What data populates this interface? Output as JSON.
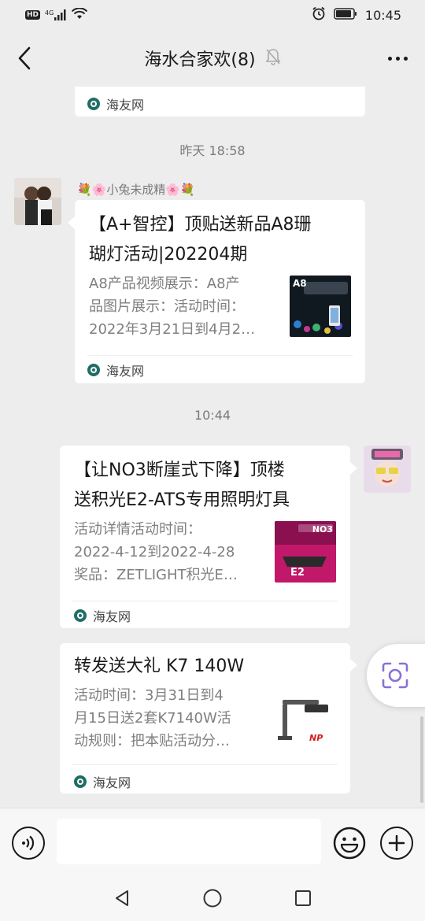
{
  "status_bar": {
    "hd": "HD",
    "network": "4G",
    "time": "10:45"
  },
  "header": {
    "title": "海水合家欢(8)",
    "mute_icon": "bell-off-icon",
    "more_icon": "more-dots-icon"
  },
  "messages": [
    {
      "source": "海友网"
    },
    {
      "timestamp": "昨天 18:58",
      "sender": "💐🌸小兔未成精🌸💐",
      "title_lines": [
        "【A+智控】顶贴送新品A8珊",
        "瑚灯活动|202204期"
      ],
      "desc_lines": [
        "A8产品视频展示：A8产",
        "品图片展示：活动时间：",
        "2022年3月21日到4月2…"
      ],
      "thumb_label": "A8",
      "source": "海友网"
    },
    {
      "timestamp": "10:44",
      "title_lines": [
        "【让NO3断崖式下降】顶楼",
        "送积光E2-ATS专用照明灯具"
      ],
      "desc_lines": [
        "活动详情活动时间：",
        "2022-4-12到2022-4-28",
        "奖品：ZETLIGHT积光E…"
      ],
      "thumb_label": "NO3",
      "thumb_label2": "E2",
      "source": "海友网"
    },
    {
      "title_lines": [
        "转发送大礼 K7 140W"
      ],
      "desc_lines": [
        "活动时间：3月31日到4",
        "月15日送2套K7140W活",
        "动规则：把本贴活动分…"
      ],
      "thumb_label": "NP",
      "source": "海友网"
    }
  ],
  "input": {
    "placeholder": "",
    "voice_icon": "voice-icon",
    "emoji_icon": "emoji-icon",
    "plus_icon": "plus-icon"
  },
  "colors": {
    "background": "#ededed",
    "card": "#ffffff",
    "secondary_text": "#7f7f7f",
    "floating_icon": "#8a6fd6"
  }
}
